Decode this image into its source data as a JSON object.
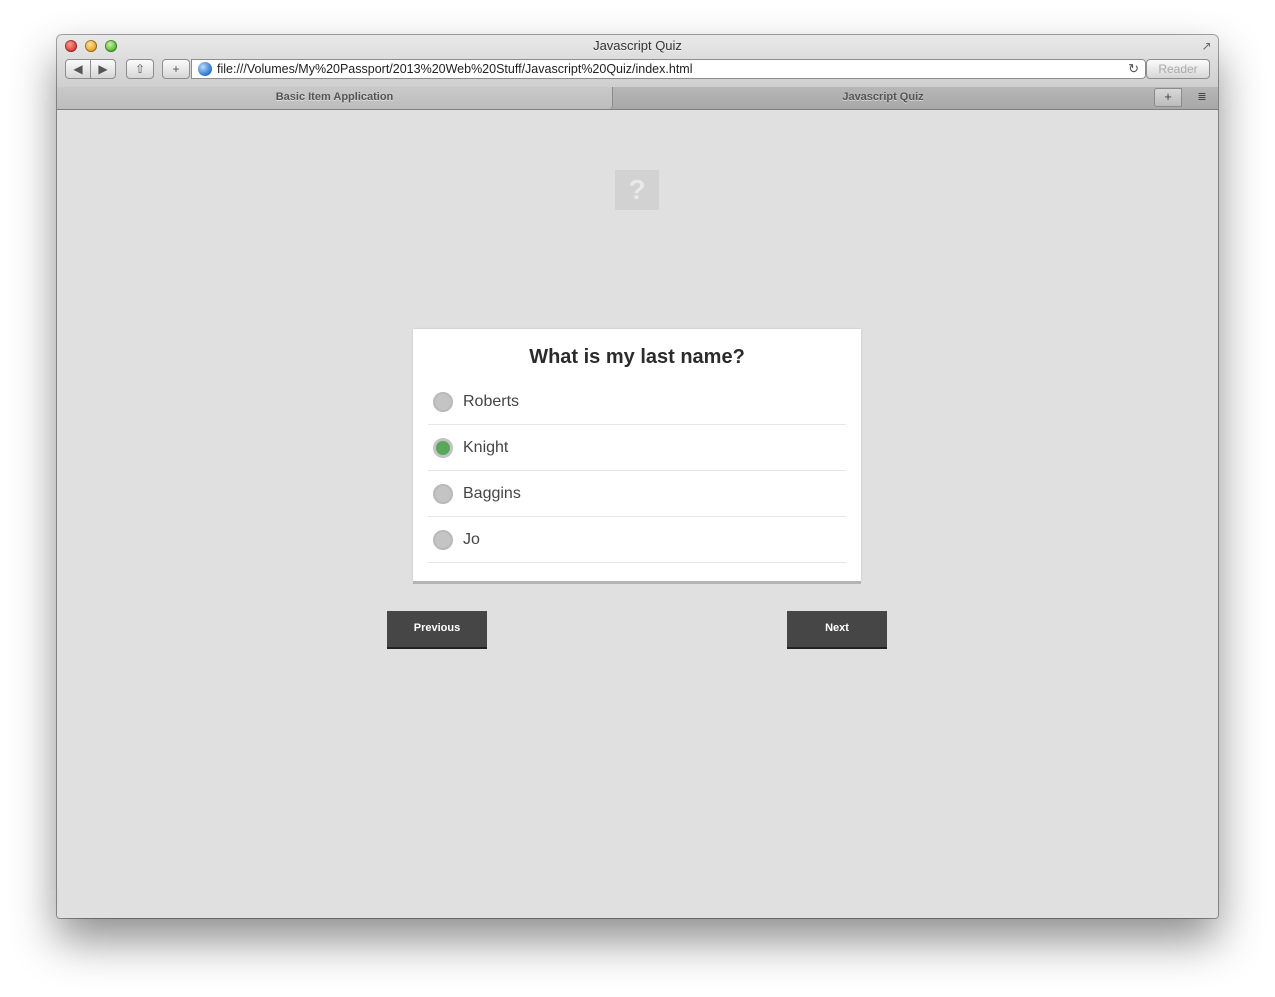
{
  "window": {
    "title": "Javascript Quiz"
  },
  "toolbar": {
    "back_icon": "◀",
    "forward_icon": "▶",
    "share_icon": "⇧",
    "add_icon": "+",
    "url": "file:///Volumes/My%20Passport/2013%20Web%20Stuff/Javascript%20Quiz/index.html",
    "reload_icon": "↻",
    "reader_label": "Reader"
  },
  "tabs": [
    {
      "label": "Basic Item Application"
    },
    {
      "label": "Javascript Quiz"
    }
  ],
  "tabbar": {
    "new_tab_icon": "+",
    "tab_view_icon": "≣"
  },
  "page": {
    "logo_glyph": "?",
    "question": "What is my last name?",
    "choices": [
      {
        "label": "Roberts",
        "selected": false
      },
      {
        "label": "Knight",
        "selected": true
      },
      {
        "label": "Baggins",
        "selected": false
      },
      {
        "label": "Jo",
        "selected": false
      }
    ],
    "prev_label": "Previous",
    "next_label": "Next",
    "accent_color": "#59a85a"
  }
}
